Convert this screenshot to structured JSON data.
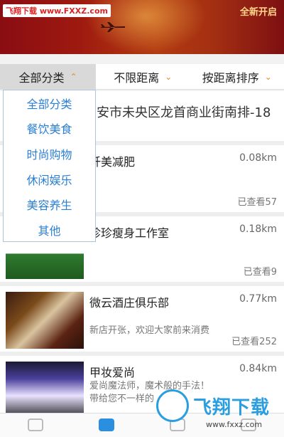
{
  "banner": {
    "watermark": "飞翔下载 www.FXXZ.com",
    "title": "全新开启"
  },
  "filters": [
    {
      "label": "全部分类",
      "icon": "chevron-up-icon"
    },
    {
      "label": "不限距离",
      "icon": "chevron-down-icon"
    },
    {
      "label": "按距离排序",
      "icon": "chevron-down-icon"
    }
  ],
  "dropdown": [
    "全部分类",
    "餐饮美食",
    "时尚购物",
    "休闲娱乐",
    "美容养生",
    "其他"
  ],
  "address": "安市未央区龙首商业街南排-18",
  "listings": [
    {
      "title": "纤美减肥",
      "distance": "0.08km",
      "desc": "",
      "views": "已查看57"
    },
    {
      "title": "珍珍瘦身工作室",
      "distance": "0.18km",
      "desc": "",
      "views": "已查看9"
    },
    {
      "title": "微云酒庄俱乐部",
      "distance": "0.77km",
      "desc": "新店开张，欢迎大家前来消费",
      "views": "已查看252"
    },
    {
      "title": "甲妆爱尚",
      "distance": "0.84km",
      "desc": "爱尚魔法师，魔术般的手法！带给您不一样的",
      "views": ""
    }
  ],
  "bottom_watermark": {
    "text": "飞翔下载",
    "url": "www.fxxz.com"
  },
  "colors": {
    "accent": "#2b7fd4",
    "banner": "#9e1a10"
  }
}
